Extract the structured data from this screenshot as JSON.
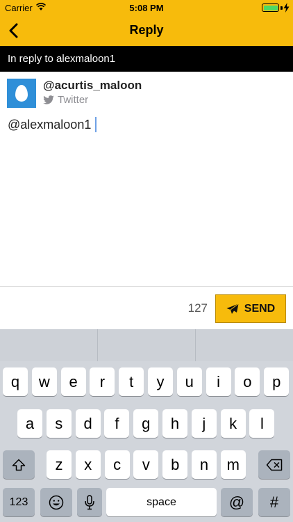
{
  "status_bar": {
    "carrier": "Carrier",
    "time": "5:08 PM",
    "battery_level": 1.0
  },
  "nav": {
    "title": "Reply",
    "back_icon": "chevron-left-icon"
  },
  "reply_banner": {
    "text": "In reply to alexmaloon1"
  },
  "account": {
    "handle": "@acurtis_maloon",
    "service": "Twitter"
  },
  "compose": {
    "text": "@alexmaloon1"
  },
  "footer": {
    "char_count": "127",
    "send_label": "SEND"
  },
  "keyboard": {
    "row1": [
      "q",
      "w",
      "e",
      "r",
      "t",
      "y",
      "u",
      "i",
      "o",
      "p"
    ],
    "row2": [
      "a",
      "s",
      "d",
      "f",
      "g",
      "h",
      "j",
      "k",
      "l"
    ],
    "row3": [
      "z",
      "x",
      "c",
      "v",
      "b",
      "n",
      "m"
    ],
    "numbers_label": "123",
    "space_label": "space",
    "at_label": "@",
    "hash_label": "#"
  },
  "colors": {
    "accent": "#f7bb0c",
    "banner": "#000000",
    "avatar": "#2f8fd8",
    "caret": "#6ea1e6"
  }
}
